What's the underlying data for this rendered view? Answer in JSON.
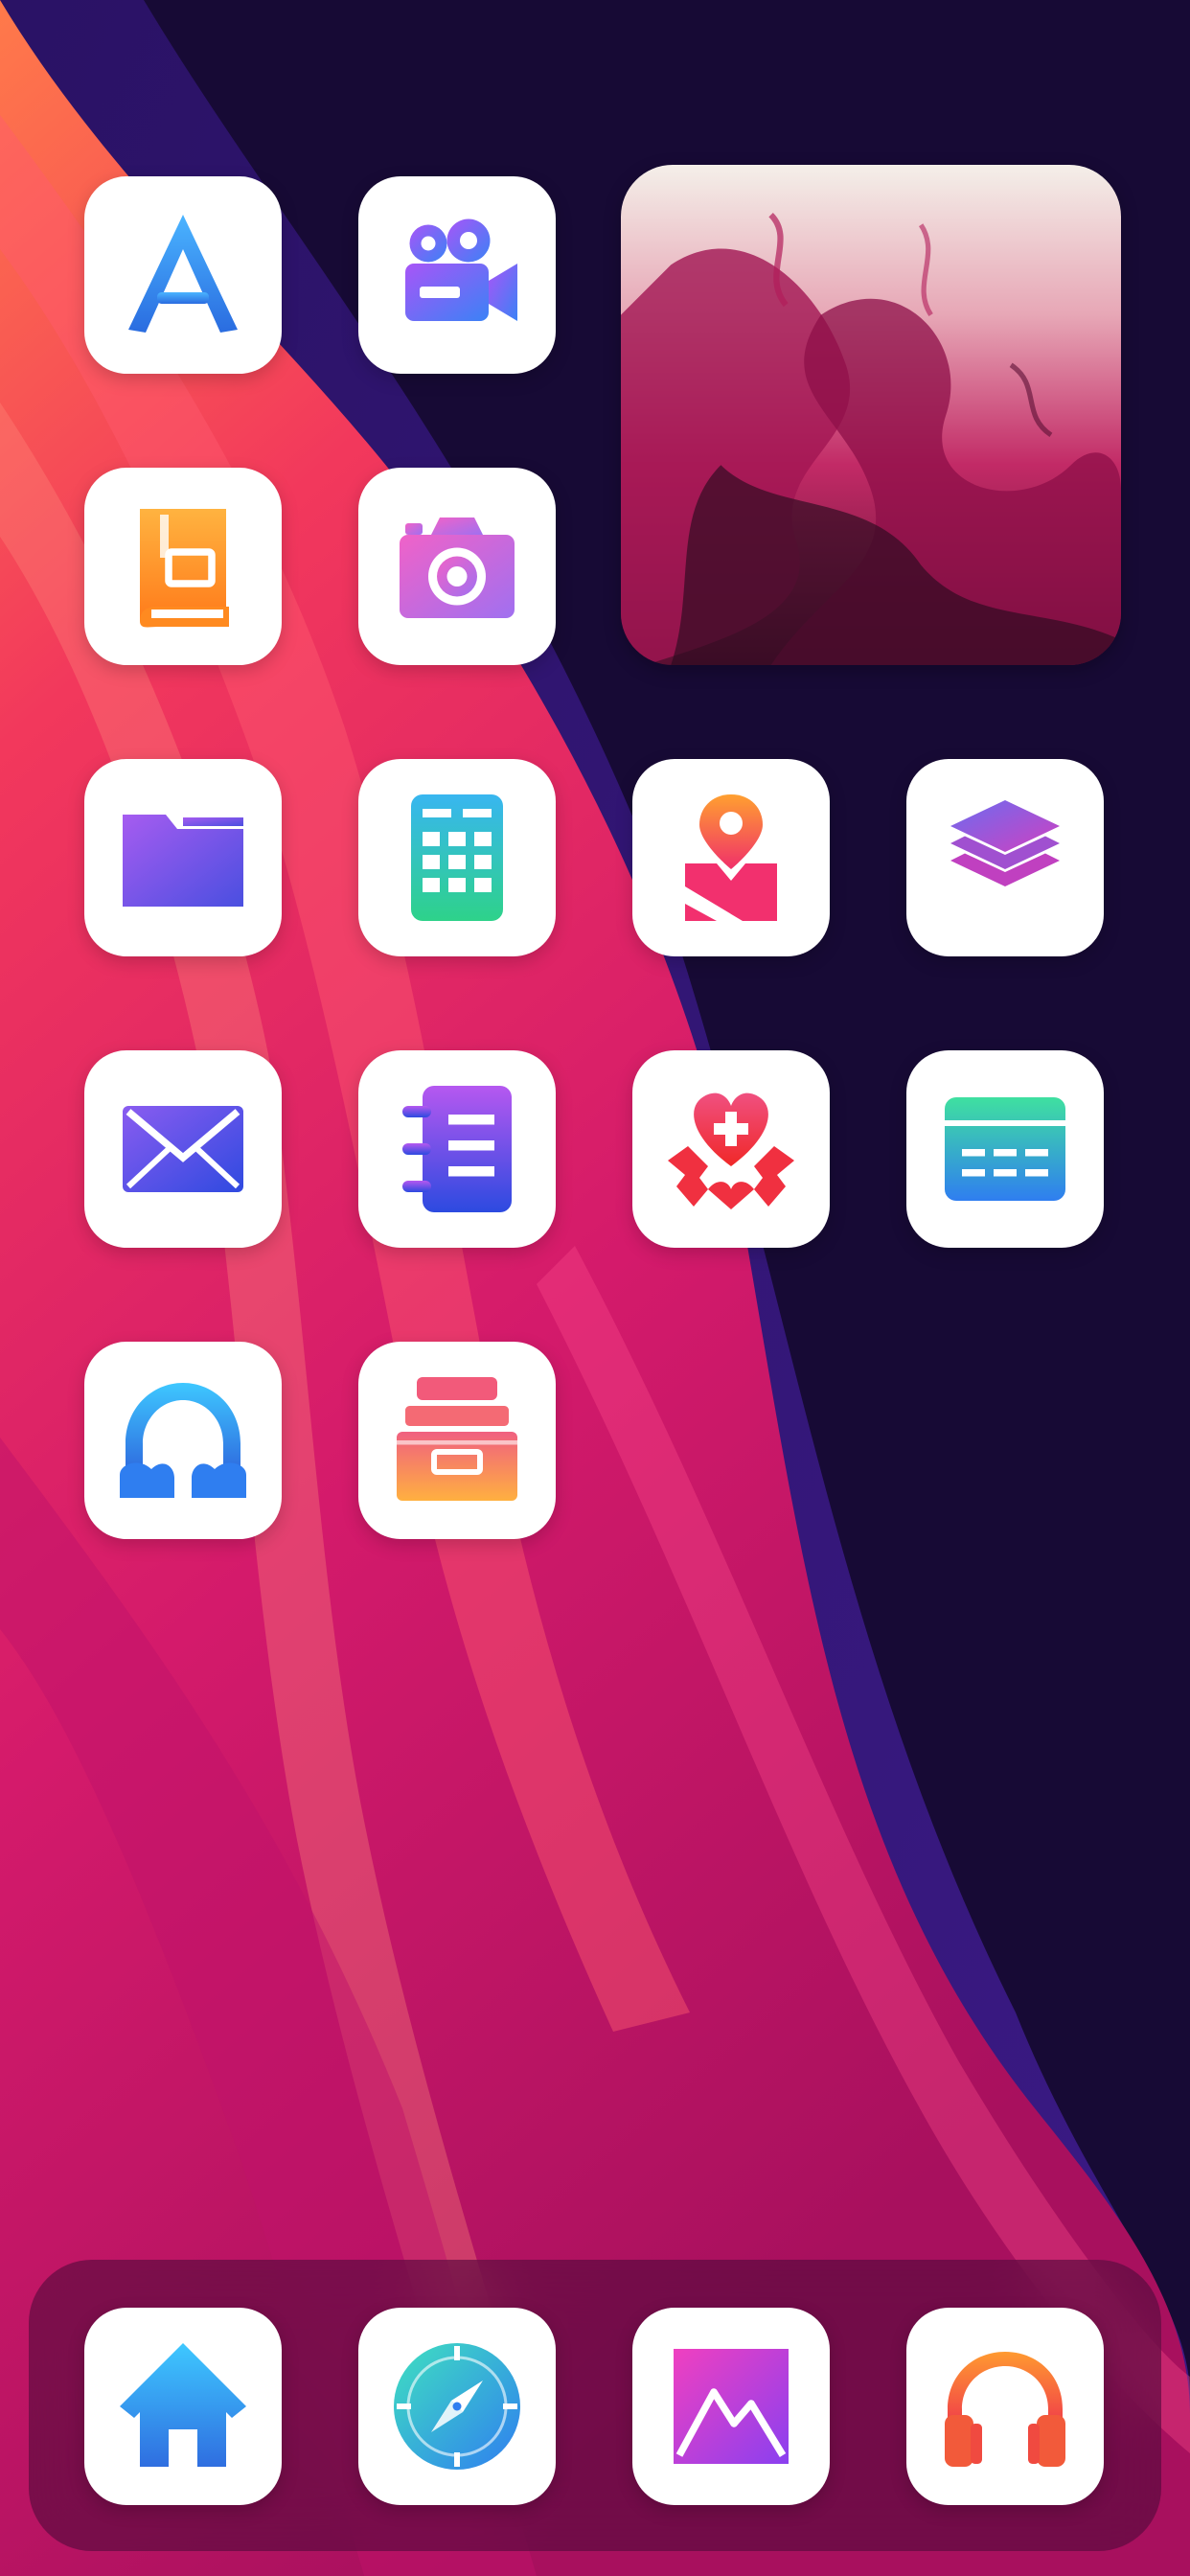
{
  "home_screen": {
    "apps": [
      {
        "name": "app-store-icon"
      },
      {
        "name": "video-camera-icon"
      },
      {
        "name": "books-icon"
      },
      {
        "name": "camera-icon"
      },
      {
        "name": "folder-icon"
      },
      {
        "name": "calculator-icon"
      },
      {
        "name": "maps-icon"
      },
      {
        "name": "layers-icon"
      },
      {
        "name": "mail-icon"
      },
      {
        "name": "notes-icon"
      },
      {
        "name": "health-icon"
      },
      {
        "name": "calendar-icon"
      },
      {
        "name": "headphones-arch-icon"
      },
      {
        "name": "archive-icon"
      }
    ],
    "widget": {
      "type": "photo",
      "subject": "ink-in-water"
    }
  },
  "dock": {
    "apps": [
      {
        "name": "home-icon"
      },
      {
        "name": "safari-compass-icon"
      },
      {
        "name": "photos-icon"
      },
      {
        "name": "music-headphones-icon"
      }
    ]
  },
  "colors": {
    "background_dark": "#170a35",
    "wave_pink": "#e0216c",
    "wave_purple": "#3a1a7a",
    "icon_tile": "#ffffff",
    "blue": "#2f8cf0",
    "magenta": "#e03cc8",
    "orange": "#ff9a30"
  }
}
